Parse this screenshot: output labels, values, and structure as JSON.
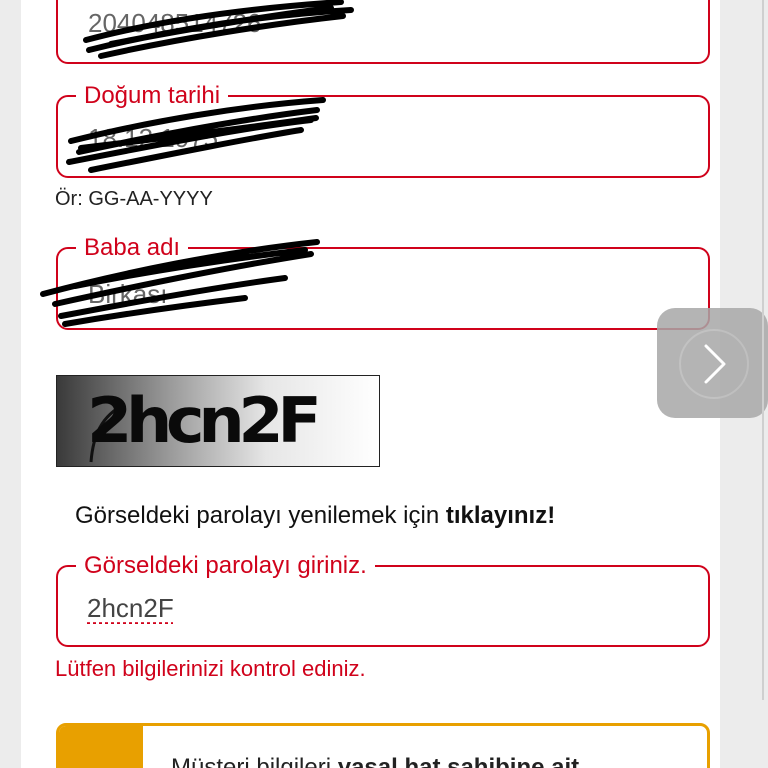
{
  "form": {
    "id_field": {
      "value": "204048514726"
    },
    "birth_date": {
      "label": "Doğum tarihi",
      "value": "18.12.1975",
      "hint": "Ör: GG-AA-YYYY"
    },
    "father_name": {
      "label": "Baba adı",
      "value": "Birkası"
    },
    "captcha": {
      "image_text": "2hcn2F",
      "refresh_text": "Görseldeki parolayı yenilemek için ",
      "refresh_link": "tıklayınız!",
      "input_label": "Görseldeki parolayı giriniz.",
      "input_value": "2hcn2F"
    },
    "error": "Lütfen bilgilerinizi kontrol ediniz.",
    "notice": {
      "text": "Müşteri bilgileri ",
      "bold": "yasal hat sahibine ait"
    }
  },
  "colors": {
    "accent": "#d0021b",
    "notice": "#e8a000"
  },
  "icons": {
    "next": "chevron-right-icon"
  }
}
